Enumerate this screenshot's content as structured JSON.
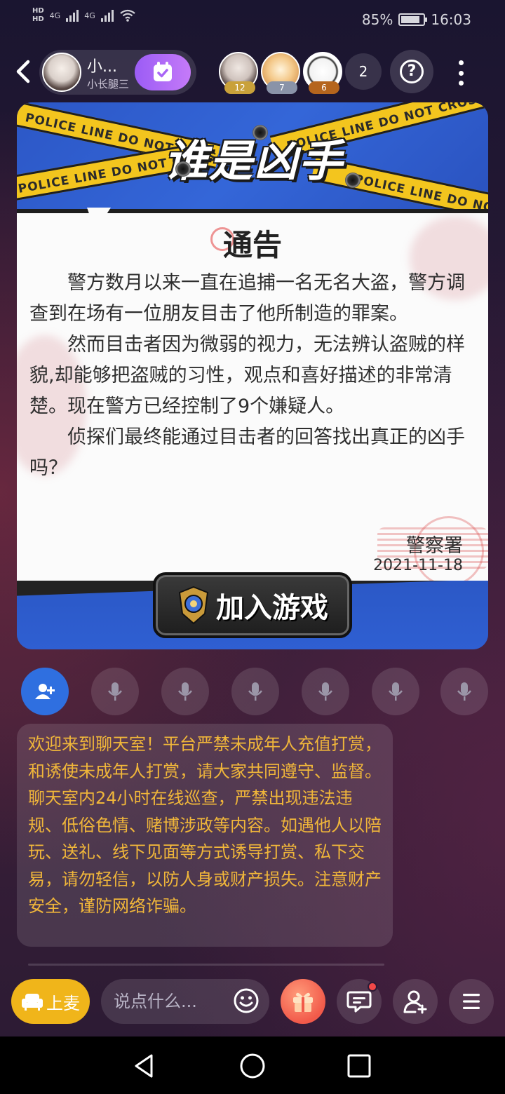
{
  "status_bar": {
    "hd1": "HD",
    "hd2": "HD",
    "net1": "4G",
    "net2": "4G",
    "battery_percent": "85%",
    "battery_level": 0.85,
    "time": "16:03"
  },
  "header": {
    "host_name": "小...",
    "host_subtitle": "小长腿三",
    "viewers": [
      {
        "level": "12",
        "badge_color": "#c9a13a"
      },
      {
        "level": "7",
        "badge_color": "#8a93a8"
      },
      {
        "level": "6",
        "badge_color": "#b5651d"
      }
    ],
    "online_count": "2",
    "help_label": "?"
  },
  "game_card": {
    "tape_text": "POLICE LINE DO NOT CROSS",
    "game_title": "谁是凶手",
    "notice_title": "通告",
    "paragraphs": [
      "警方数月以来一直在追捕一名无名大盗，警方调查到在场有一位朋友目击了他所制造的罪案。",
      "然而目击者因为微弱的视力，无法辨认盗贼的样貌,却能够把盗贼的习性，观点和喜好描述的非常清楚。现在警方已经控制了9个嫌疑人。",
      "侦探们最终能通过目击者的回答找出真正的凶手吗？"
    ],
    "signature": "警察署",
    "date": "2021-11-18",
    "join_label": "加入游戏"
  },
  "seats": {
    "invite_icon": "add-user-icon",
    "empty_seat_icon": "microphone-icon",
    "empty_seat_count": 6
  },
  "chat": {
    "system_message": "欢迎来到聊天室！平台严禁未成年人充值打赏，和诱使未成年人打赏，请大家共同遵守、监督。聊天室内24小时在线巡查，严禁出现违法违规、低俗色情、赌博涉政等内容。如遇他人以陪玩、送礼、线下见面等方式诱导打赏、私下交易，请勿轻信，以防人身或财产损失。注意财产安全，谨防网络诈骗。",
    "system_message_color": "#f0b63a"
  },
  "bottom_bar": {
    "mic_label": "上麦",
    "input_placeholder": "说点什么...",
    "accent_color": "#f0b51a"
  }
}
